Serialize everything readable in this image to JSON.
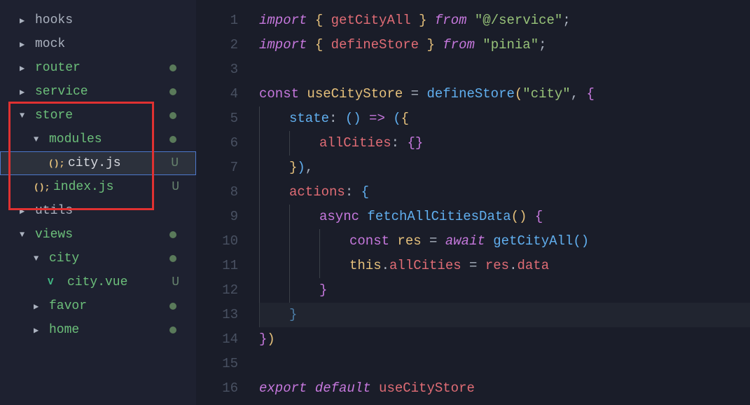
{
  "sidebar": {
    "items": [
      {
        "label": "hooks",
        "type": "folder",
        "icon": "chevron-right",
        "status": "none",
        "indent": 0,
        "color": "neutral"
      },
      {
        "label": "mock",
        "type": "folder",
        "icon": "chevron-right",
        "status": "none",
        "indent": 0,
        "color": "neutral"
      },
      {
        "label": "router",
        "type": "folder",
        "icon": "chevron-right",
        "status": "modified",
        "indent": 0,
        "color": "green"
      },
      {
        "label": "service",
        "type": "folder",
        "icon": "chevron-right",
        "status": "modified",
        "indent": 0,
        "color": "green"
      },
      {
        "label": "store",
        "type": "folder",
        "icon": "chevron-down",
        "status": "modified",
        "indent": 0,
        "color": "green"
      },
      {
        "label": "modules",
        "type": "folder",
        "icon": "chevron-down",
        "status": "modified",
        "indent": 1,
        "color": "green"
      },
      {
        "label": "city.js",
        "type": "file",
        "icon": "js",
        "status": "untracked",
        "indent": 2,
        "selected": true,
        "color": "neutral"
      },
      {
        "label": "index.js",
        "type": "file",
        "icon": "js",
        "status": "untracked",
        "indent": 1,
        "color": "green"
      },
      {
        "label": "utils",
        "type": "folder",
        "icon": "chevron-right",
        "status": "none",
        "indent": 0,
        "color": "neutral"
      },
      {
        "label": "views",
        "type": "folder",
        "icon": "chevron-down",
        "status": "modified",
        "indent": 0,
        "color": "green"
      },
      {
        "label": "city",
        "type": "folder",
        "icon": "chevron-down",
        "status": "modified",
        "indent": 1,
        "color": "green"
      },
      {
        "label": "city.vue",
        "type": "file",
        "icon": "vue",
        "status": "untracked",
        "indent": 2,
        "color": "green"
      },
      {
        "label": "favor",
        "type": "folder",
        "icon": "chevron-right",
        "status": "modified",
        "indent": 1,
        "color": "green"
      },
      {
        "label": "home",
        "type": "folder",
        "icon": "chevron-right",
        "status": "modified",
        "indent": 1,
        "color": "green"
      }
    ]
  },
  "editor": {
    "lineNumbers": [
      "1",
      "2",
      "3",
      "4",
      "5",
      "6",
      "7",
      "8",
      "9",
      "10",
      "11",
      "12",
      "13",
      "14",
      "15",
      "16"
    ],
    "code": {
      "l1_import": "import",
      "l1_brace_o": "{ ",
      "l1_ident": "getCityAll",
      "l1_brace_c": " }",
      "l1_from": " from ",
      "l1_str": "\"@/service\"",
      "l1_semi": ";",
      "l2_import": "import",
      "l2_brace_o": "{ ",
      "l2_ident": "defineStore",
      "l2_brace_c": " }",
      "l2_from": " from ",
      "l2_str": "\"pinia\"",
      "l2_semi": ";",
      "l4_const": "const ",
      "l4_name": "useCityStore",
      "l4_eq": " = ",
      "l4_fn": "defineStore",
      "l4_po": "(",
      "l4_str": "\"city\"",
      "l4_comma": ", ",
      "l4_bo": "{",
      "l5_state": "state",
      "l5_colon": ": ",
      "l5_po": "(",
      "l5_pc": ") ",
      "l5_arrow": "=> ",
      "l5_p2o": "(",
      "l5_bo": "{",
      "l6_key": "allCities",
      "l6_colon": ": ",
      "l6_bo": "{",
      "l6_bc": "}",
      "l7_bc": "}",
      "l7_pc": ")",
      "l7_comma": ",",
      "l8_actions": "actions",
      "l8_colon": ": ",
      "l8_bo": "{",
      "l9_async": "async ",
      "l9_fn": "fetchAllCitiesData",
      "l9_po": "(",
      "l9_pc": ") ",
      "l9_bo": "{",
      "l10_const": "const ",
      "l10_res": "res",
      "l10_eq": " = ",
      "l10_await": "await ",
      "l10_fn": "getCityAll",
      "l10_po": "(",
      "l10_pc": ")",
      "l11_this": "this",
      "l11_dot": ".",
      "l11_prop": "allCities",
      "l11_eq": " = ",
      "l11_res": "res",
      "l11_dot2": ".",
      "l11_data": "data",
      "l12_bc": "}",
      "l13_bc": "}",
      "l14_bc": "}",
      "l14_pc": ")",
      "l16_export": "export ",
      "l16_default": "default ",
      "l16_name": "useCityStore"
    }
  }
}
